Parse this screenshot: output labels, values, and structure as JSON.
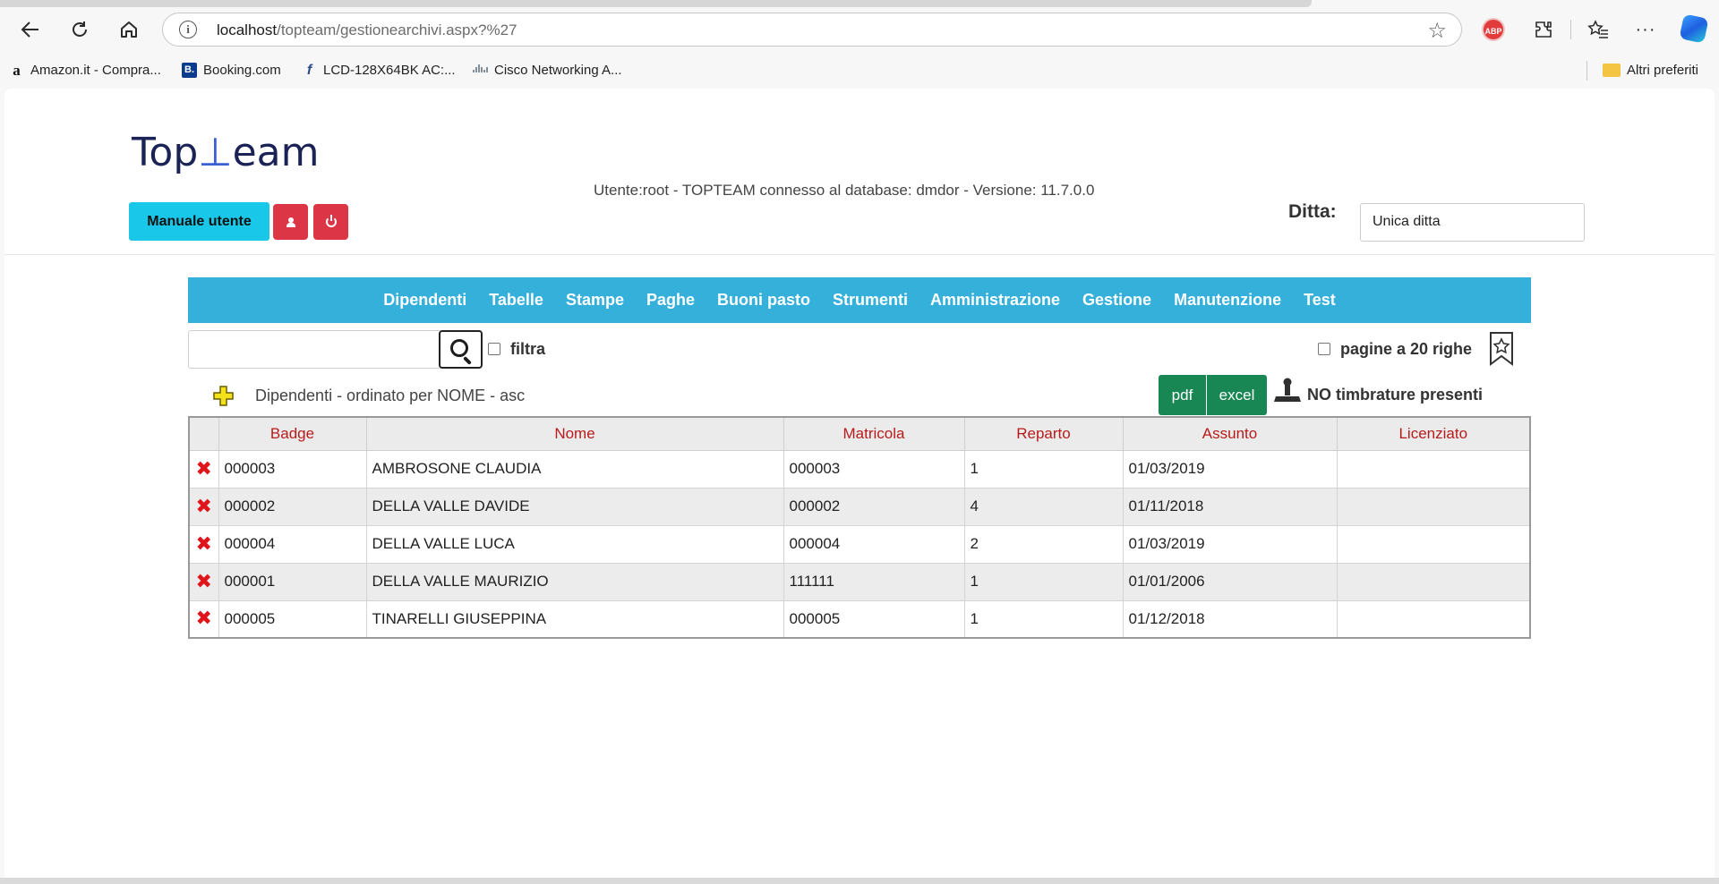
{
  "browser": {
    "url_host": "localhost",
    "url_path": "/topteam/gestionearchivi.aspx?%27",
    "abp_label": "ABP",
    "bookmarks": [
      {
        "label": "Amazon.it - Compra...",
        "icon": "amazon-icon"
      },
      {
        "label": "Booking.com",
        "icon": "booking-icon"
      },
      {
        "label": "LCD-128X64BK AC:...",
        "icon": "lcd-icon"
      },
      {
        "label": "Cisco Networking A...",
        "icon": "cisco-icon"
      }
    ],
    "other_favorites": "Altri preferiti",
    "booking_glyph": "B.",
    "amazon_glyph": "a",
    "lcd_glyph": "f"
  },
  "header": {
    "logo_text_1": "Top",
    "logo_t": "⊥",
    "logo_text_2": "eam",
    "manual_button": "Manuale utente",
    "user_info": "Utente:root - TOPTEAM connesso al database: dmdor - Versione: 11.7.0.0",
    "ditta_label": "Ditta:",
    "ditta_value": "Unica ditta"
  },
  "menu": [
    "Dipendenti",
    "Tabelle",
    "Stampe",
    "Paghe",
    "Buoni pasto",
    "Strumenti",
    "Amministrazione",
    "Gestione",
    "Manutenzione",
    "Test"
  ],
  "toolbar": {
    "search_value": "",
    "filter_label": "filtra",
    "pages_label": "pagine a 20 righe",
    "order_label": "Dipendenti - ordinato per NOME - asc",
    "pdf_label": "pdf",
    "excel_label": "excel",
    "no_timbrature_label": "NO timbrature presenti"
  },
  "table": {
    "columns": [
      "Badge",
      "Nome",
      "Matricola",
      "Reparto",
      "Assunto",
      "Licenziato"
    ],
    "rows": [
      {
        "badge": "000003",
        "nome": "AMBROSONE CLAUDIA",
        "matricola": "000003",
        "reparto": "1",
        "assunto": "01/03/2019",
        "licenziato": ""
      },
      {
        "badge": "000002",
        "nome": "DELLA VALLE DAVIDE",
        "matricola": "000002",
        "reparto": "4",
        "assunto": "01/11/2018",
        "licenziato": ""
      },
      {
        "badge": "000004",
        "nome": "DELLA VALLE LUCA",
        "matricola": "000004",
        "reparto": "2",
        "assunto": "01/03/2019",
        "licenziato": ""
      },
      {
        "badge": "000001",
        "nome": "DELLA VALLE MAURIZIO",
        "matricola": "111111",
        "reparto": "1",
        "assunto": "01/01/2006",
        "licenziato": ""
      },
      {
        "badge": "000005",
        "nome": "TINARELLI GIUSEPPINA",
        "matricola": "000005",
        "reparto": "1",
        "assunto": "01/12/2018",
        "licenziato": ""
      }
    ]
  },
  "colors": {
    "nav_bar": "#34b0da",
    "manual_button": "#19c7e9",
    "danger": "#dc3545",
    "export_green": "#198754",
    "column_header_text": "#b81b1b",
    "delete_x": "#e0141b"
  }
}
